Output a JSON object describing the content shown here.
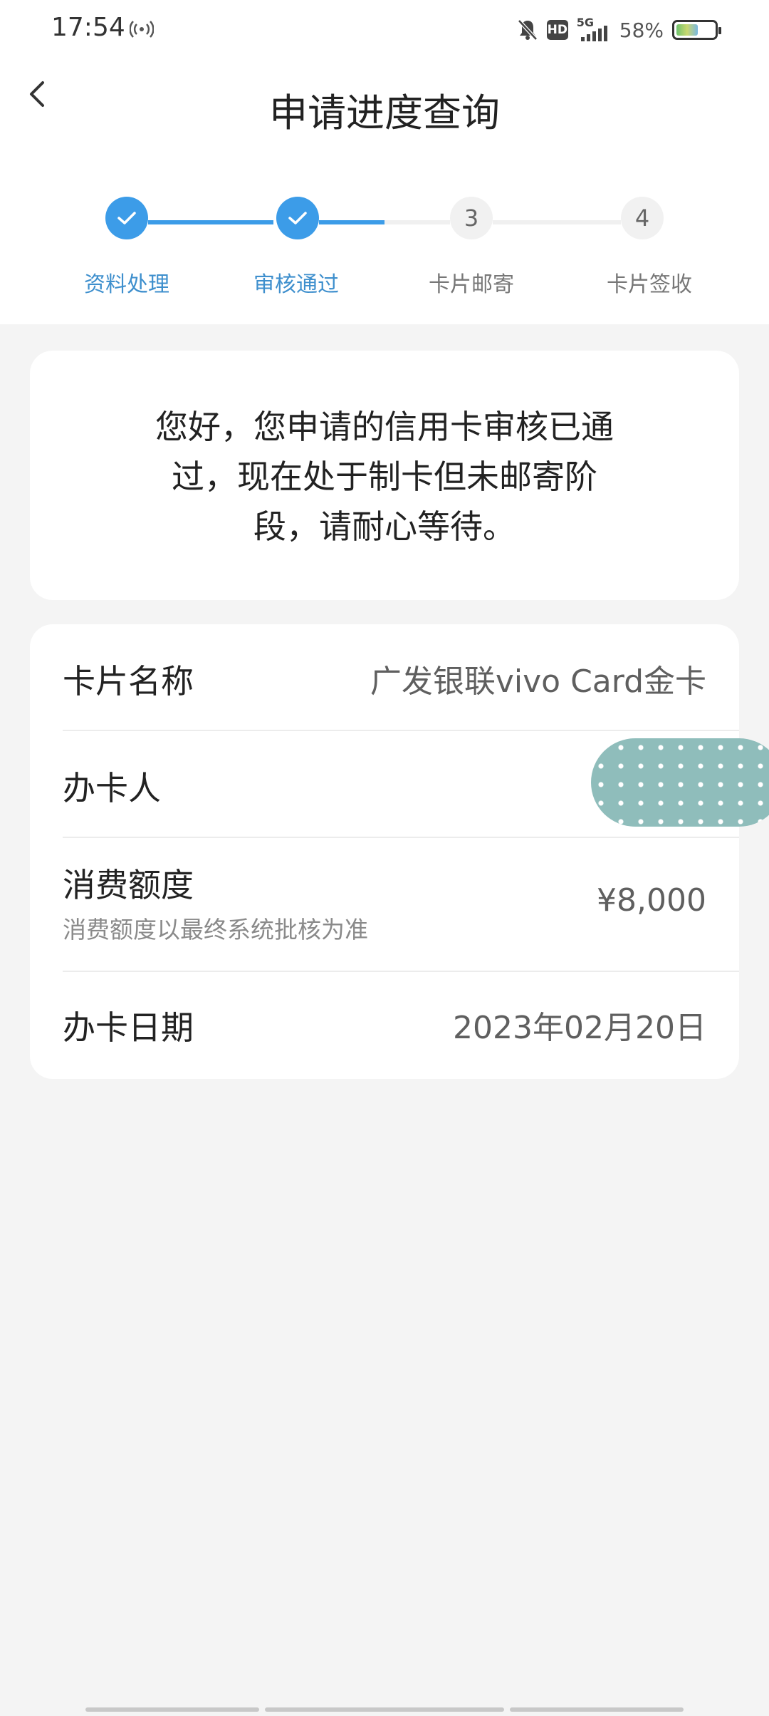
{
  "status_bar": {
    "time": "17:54",
    "network": "5G",
    "hd": "HD",
    "battery_percent": "58%",
    "battery_level": 0.58
  },
  "nav": {
    "title": "申请进度查询",
    "back_icon": "chevron-left-icon"
  },
  "stepper": {
    "steps": [
      {
        "label": "资料处理",
        "state": "done"
      },
      {
        "label": "审核通过",
        "state": "done"
      },
      {
        "number": "3",
        "label": "卡片邮寄",
        "state": "pending"
      },
      {
        "number": "4",
        "label": "卡片签收",
        "state": "pending"
      }
    ]
  },
  "message": {
    "line1": "您好，您申请的信用卡审核已通",
    "line2": "过，现在处于制卡但未邮寄阶",
    "line3": "段，请耐心等待。"
  },
  "details": {
    "card_name_label": "卡片名称",
    "card_name_value": "广发银联vivo Card金卡",
    "applicant_label": "办卡人",
    "credit_limit_label": "消费额度",
    "credit_limit_note": "消费额度以最终系统批核为准",
    "credit_limit_value": "¥8,000",
    "apply_date_label": "办卡日期",
    "apply_date_value": "2023年02月20日"
  },
  "colors": {
    "accent": "#3c9ce8",
    "step_label_done": "#3e8fcd",
    "background": "#f4f4f4"
  }
}
